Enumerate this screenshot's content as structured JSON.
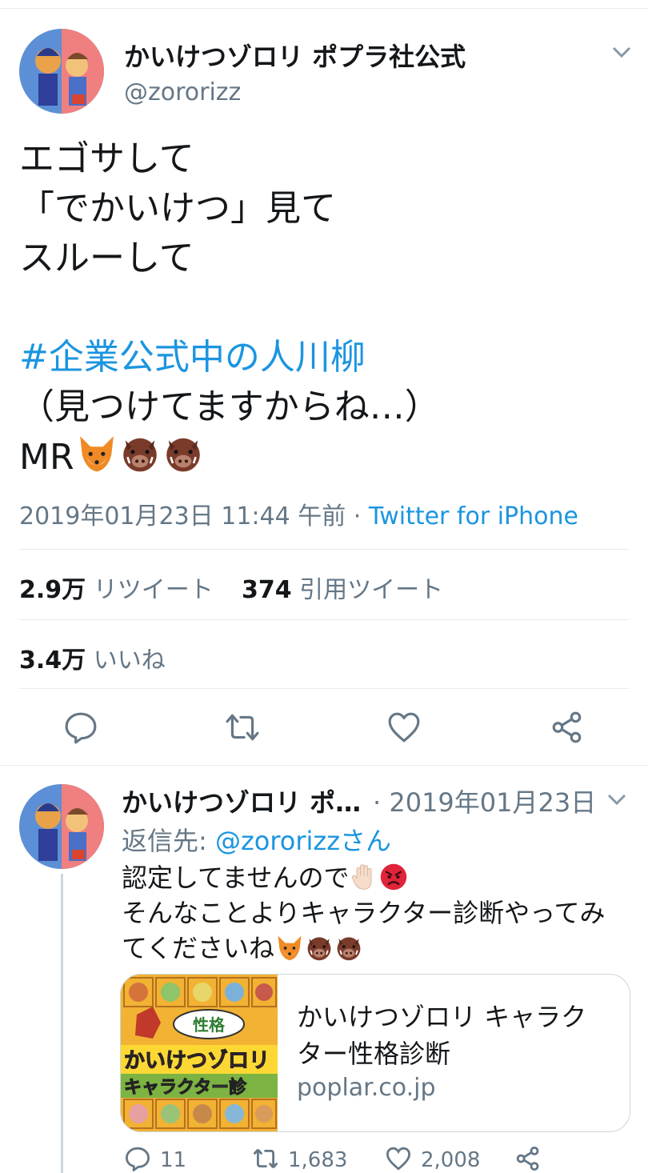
{
  "tweet": {
    "author_name": "かいけつゾロリ ポプラ社公式",
    "author_handle": "@zororizz",
    "text_lines": [
      "エゴサして",
      "「でかいけつ」見て",
      "スルーして"
    ],
    "hashtag": "#企業公式中の人川柳",
    "text_after": "（見つけてますからね…）",
    "signature": "MR",
    "signature_emoji": [
      "fox-face",
      "boar",
      "boar"
    ],
    "timestamp": "2019年01月23日 11:44 午前",
    "meta_separator": " · ",
    "source": "Twitter for iPhone",
    "retweets_count": "2.9万",
    "retweets_label": "リツイート",
    "quotes_count": "374",
    "quotes_label": "引用ツイート",
    "likes_count": "3.4万",
    "likes_label": "いいね",
    "actions": [
      "reply-icon",
      "retweet-icon",
      "like-icon",
      "share-icon"
    ]
  },
  "reply": {
    "author_name": "かいけつゾロリ ポ…",
    "date": "· 2019年01月23日",
    "reply_to_label": "返信先: ",
    "reply_to_handle": "@zororizzさん",
    "line1": "認定してませんので",
    "line1_emoji": [
      "raised-hand",
      "angry-face"
    ],
    "line2": "そんなことよりキャラクター診断やってみ",
    "line3": "てくださいね",
    "line3_emoji": [
      "fox-face",
      "boar",
      "boar"
    ],
    "card": {
      "title_line1": "かいけつゾロリ キャラク",
      "title_line2": "ター性格診断",
      "domain": "poplar.co.jp",
      "image_text_1": "かいけつゾロリ",
      "image_text_2": "キャラクター診",
      "image_furigana": "性格"
    },
    "replies_count": "11",
    "retweets_count": "1,683",
    "likes_count": "2,008"
  },
  "colors": {
    "link": "#1b95e0",
    "secondary_text": "#657786",
    "divider": "#e6ecf0"
  }
}
